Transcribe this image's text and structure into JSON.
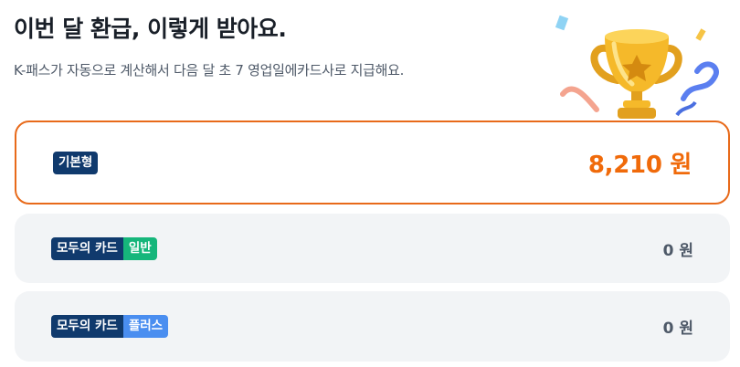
{
  "header": {
    "title": "이번 달 환급, 이렇게 받아요.",
    "subtitle": "K-패스가 자동으로 계산해서 다음 달 초 7 영업일에카드사로 지급해요."
  },
  "illustration": {
    "icon": "trophy-icon"
  },
  "cards": [
    {
      "badges": [
        "기본형"
      ],
      "amount": "8,210 원",
      "selected": true
    },
    {
      "badges": [
        "모두의 카드",
        "일반"
      ],
      "amount": "0 원",
      "selected": false
    },
    {
      "badges": [
        "모두의 카드",
        "플러스"
      ],
      "amount": "0 원",
      "selected": false
    }
  ],
  "colors": {
    "selected_border": "#e86a1a",
    "accent_amount": "#f06a0a",
    "badge_navy": "#103a6d",
    "badge_green": "#16b67b",
    "badge_blue": "#4a8ef0",
    "card_bg": "#f2f4f6"
  }
}
